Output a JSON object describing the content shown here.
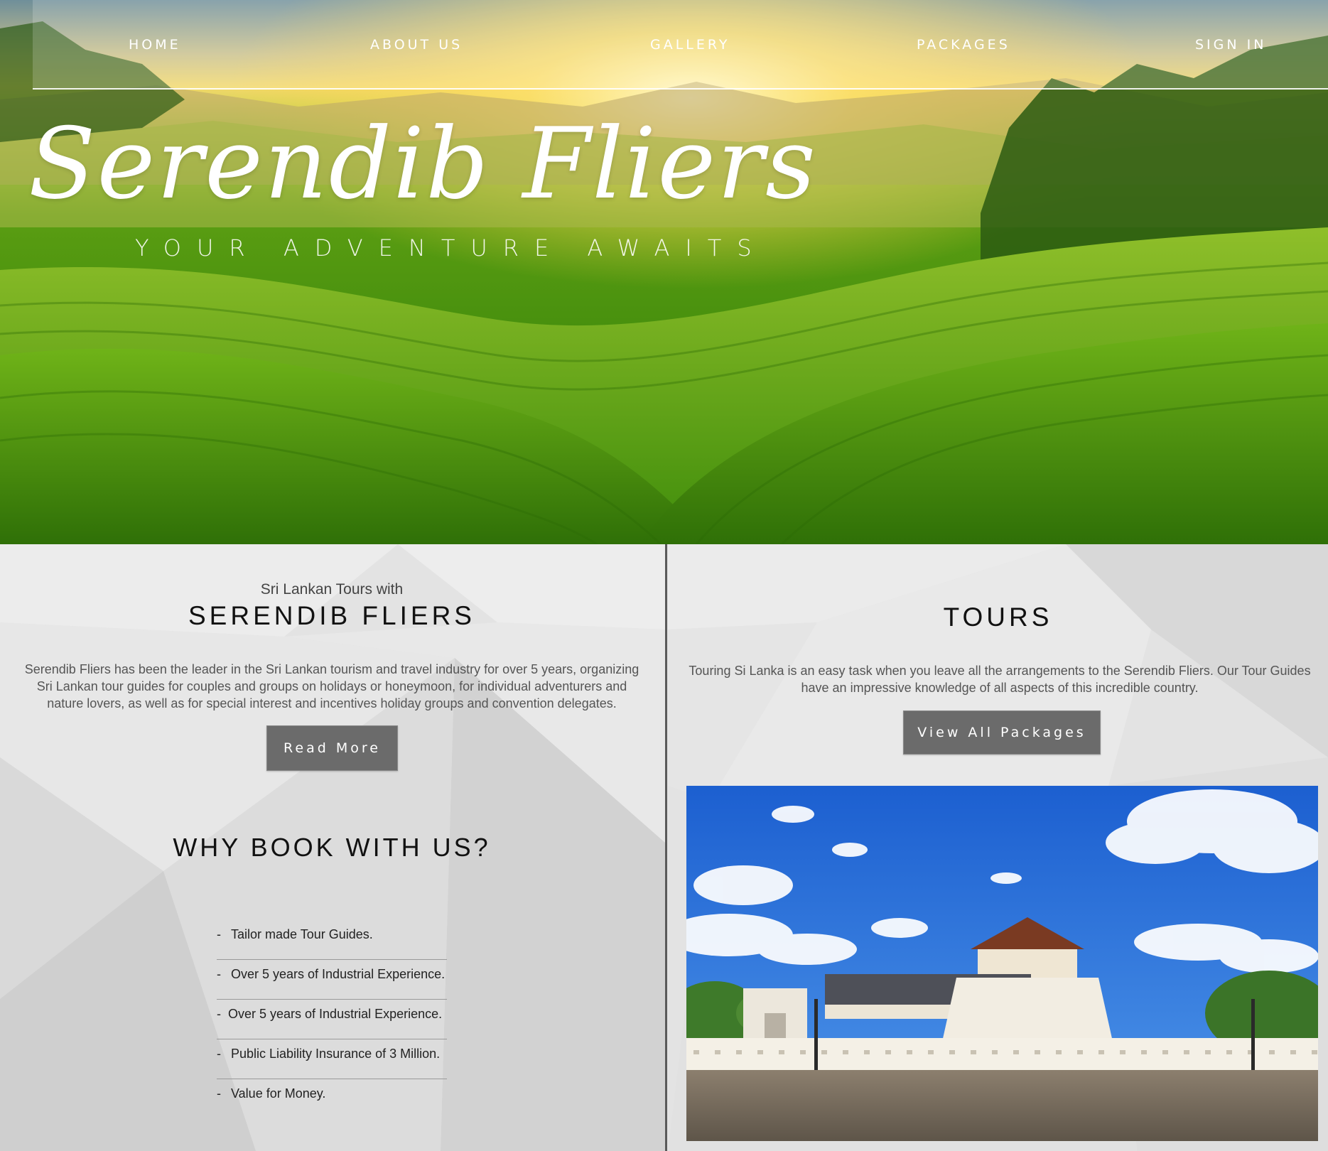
{
  "nav": {
    "items": [
      {
        "label": "HOME"
      },
      {
        "label": "ABOUT US"
      },
      {
        "label": "GALLERY"
      },
      {
        "label": "PACKAGES"
      },
      {
        "label": "SIGN IN"
      }
    ]
  },
  "hero": {
    "brand": "Serendib Fliers",
    "tagline": "YOUR ADVENTURE AWAITS"
  },
  "about": {
    "kicker": "Sri Lankan Tours with",
    "heading": "SERENDIB FLIERS",
    "body": "Serendib Fliers has been the leader in the Sri Lankan tourism and travel industry for over 5 years, organizing Sri Lankan tour guides for couples and groups on holidays or honeymoon, for individual adventurers and nature lovers, as well as for special interest and incentives holiday groups and convention delegates.",
    "button_label": "Read More"
  },
  "why": {
    "heading": "WHY BOOK WITH US?",
    "items": [
      {
        "dash": "-",
        "text": "Tailor made Tour Guides."
      },
      {
        "dash": "-",
        "text": "Over 5 years of Industrial Experience."
      },
      {
        "dash": "-",
        "text": "Over 5 years of Industrial Experience."
      },
      {
        "dash": "-",
        "text": "Public Liability Insurance of 3 Million."
      },
      {
        "dash": "-",
        "text": "Value for Money."
      }
    ]
  },
  "tours": {
    "heading": "TOURS",
    "body": "Touring Si Lanka is an easy task when you leave all the arrangements to the Serendib Fliers. Our Tour Guides have an impressive knowledge of all aspects of this incredible country.",
    "button_label": "View All Packages"
  },
  "colors": {
    "button_bg": "#6b6b6b",
    "divider": "#5a5a5a",
    "hero_green": "#4f9a10"
  }
}
